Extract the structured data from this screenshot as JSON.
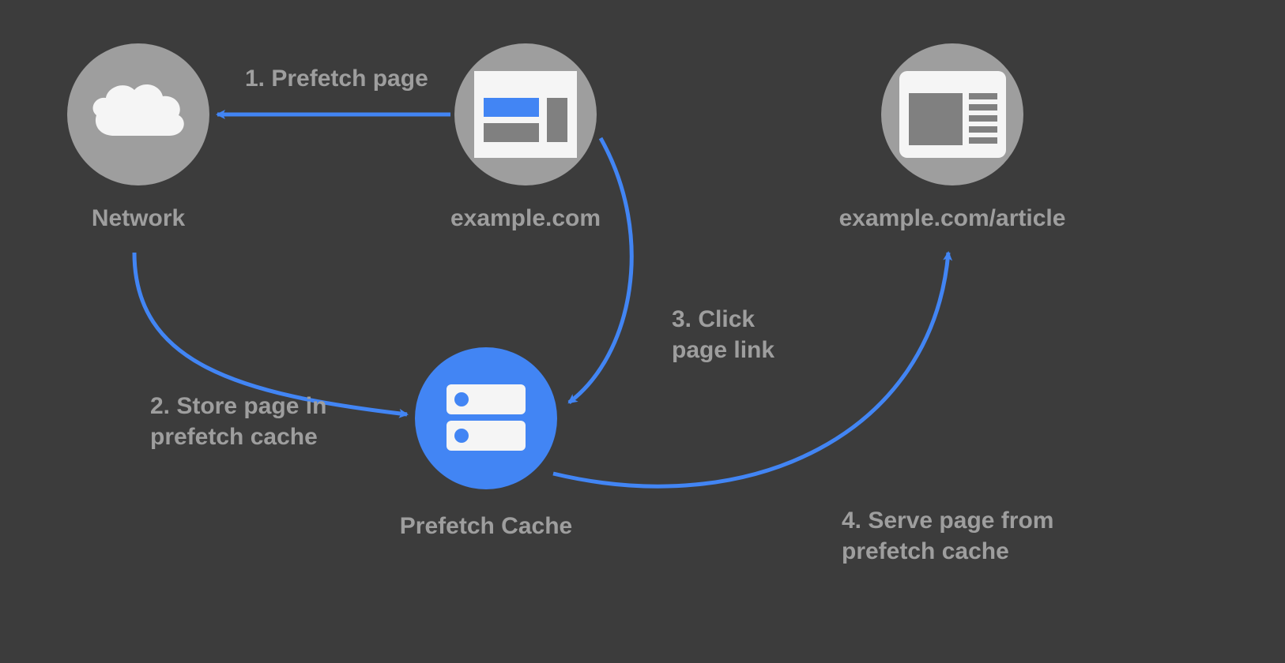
{
  "nodes": {
    "network": {
      "label": "Network"
    },
    "example": {
      "label": "example.com"
    },
    "cache": {
      "label": "Prefetch Cache"
    },
    "article": {
      "label": "example.com/article"
    }
  },
  "edges": {
    "prefetch": {
      "label": "1. Prefetch page"
    },
    "store": {
      "label_l1": "2. Store page in",
      "label_l2": "prefetch cache"
    },
    "click": {
      "label_l1": "3. Click",
      "label_l2": "page link"
    },
    "serve": {
      "label_l1": "4. Serve page from",
      "label_l2": "prefetch cache"
    }
  },
  "colors": {
    "background": "#3c3c3c",
    "node_grey": "#9e9e9e",
    "node_blue": "#4285f4",
    "text_grey": "#9e9e9e",
    "icon_white": "#f5f5f5",
    "icon_dark": "#808080",
    "icon_blue": "#4285f4"
  }
}
